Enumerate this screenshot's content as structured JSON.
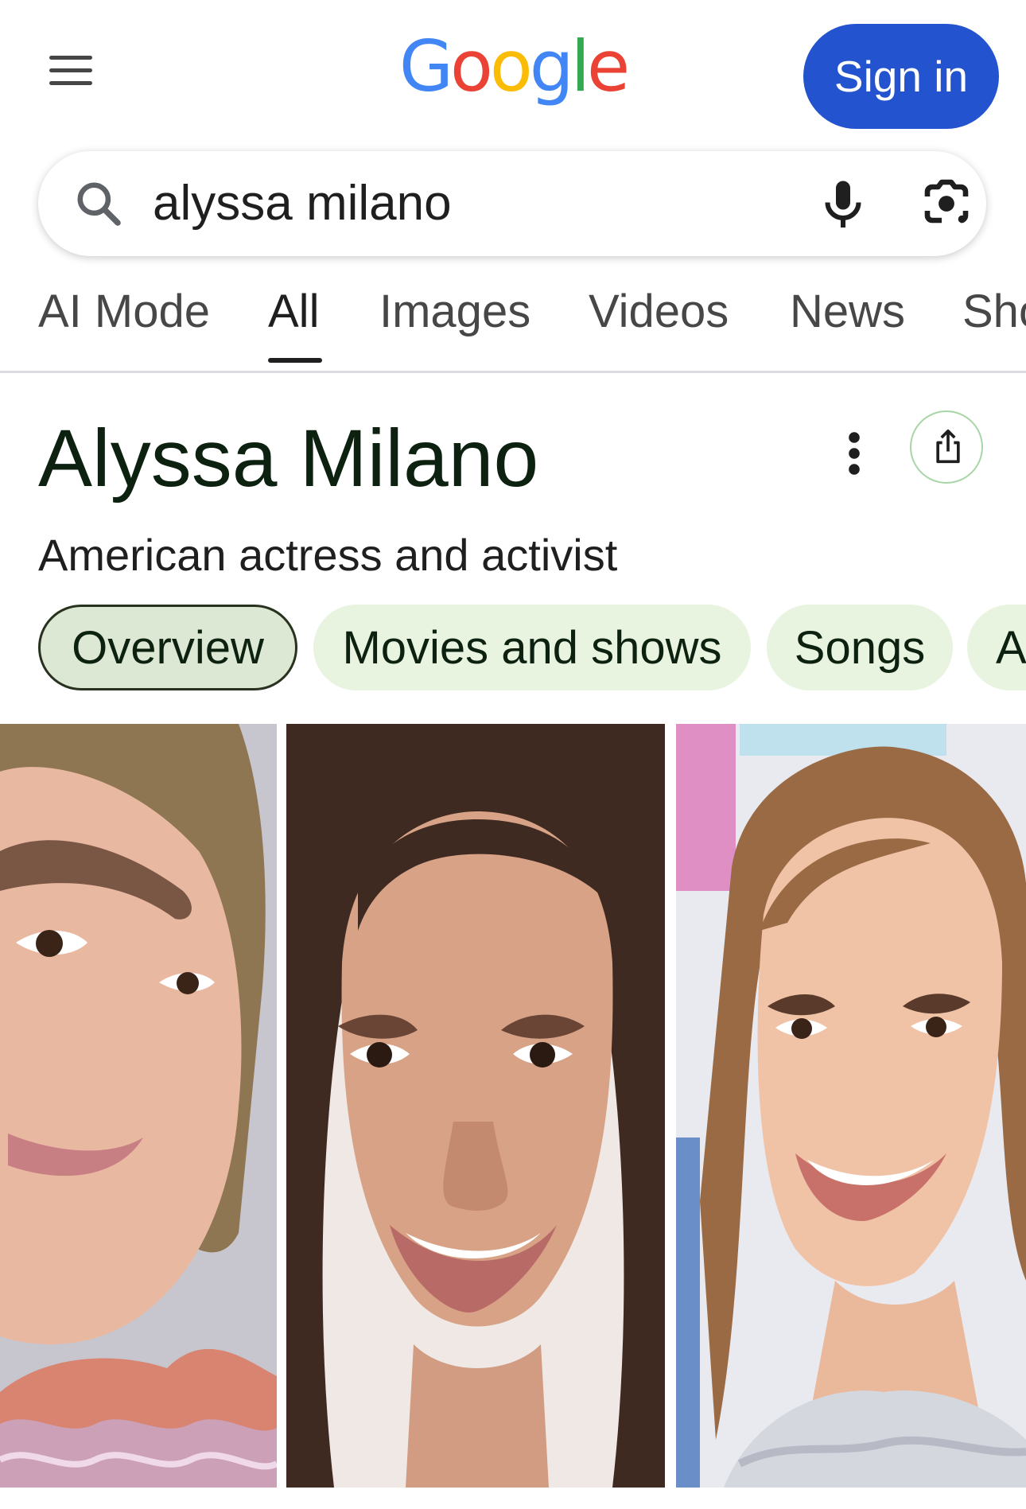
{
  "header": {
    "logo_text": "Google",
    "sign_in_label": "Sign in"
  },
  "search": {
    "query": "alyssa milano"
  },
  "tabs": [
    {
      "label": "AI Mode",
      "active": false
    },
    {
      "label": "All",
      "active": true
    },
    {
      "label": "Images",
      "active": false
    },
    {
      "label": "Videos",
      "active": false
    },
    {
      "label": "News",
      "active": false
    },
    {
      "label": "Sho",
      "active": false
    }
  ],
  "knowledge_panel": {
    "title": "Alyssa Milano",
    "subtitle": "American actress and activist",
    "chips": [
      {
        "label": "Overview",
        "selected": true
      },
      {
        "label": "Movies and shows",
        "selected": false
      },
      {
        "label": "Songs",
        "selected": false
      },
      {
        "label": "A",
        "selected": false
      }
    ]
  },
  "colors": {
    "sign_in_bg": "#2453cf",
    "chip_bg": "#e8f3e0",
    "title_color": "#0d2110",
    "google_blue": "#4285F4",
    "google_red": "#EA4335",
    "google_yellow": "#FBBC05",
    "google_green": "#34A853"
  },
  "icons": [
    "menu-icon",
    "search-icon",
    "microphone-icon",
    "lens-camera-icon",
    "more-vert-icon",
    "share-icon"
  ]
}
